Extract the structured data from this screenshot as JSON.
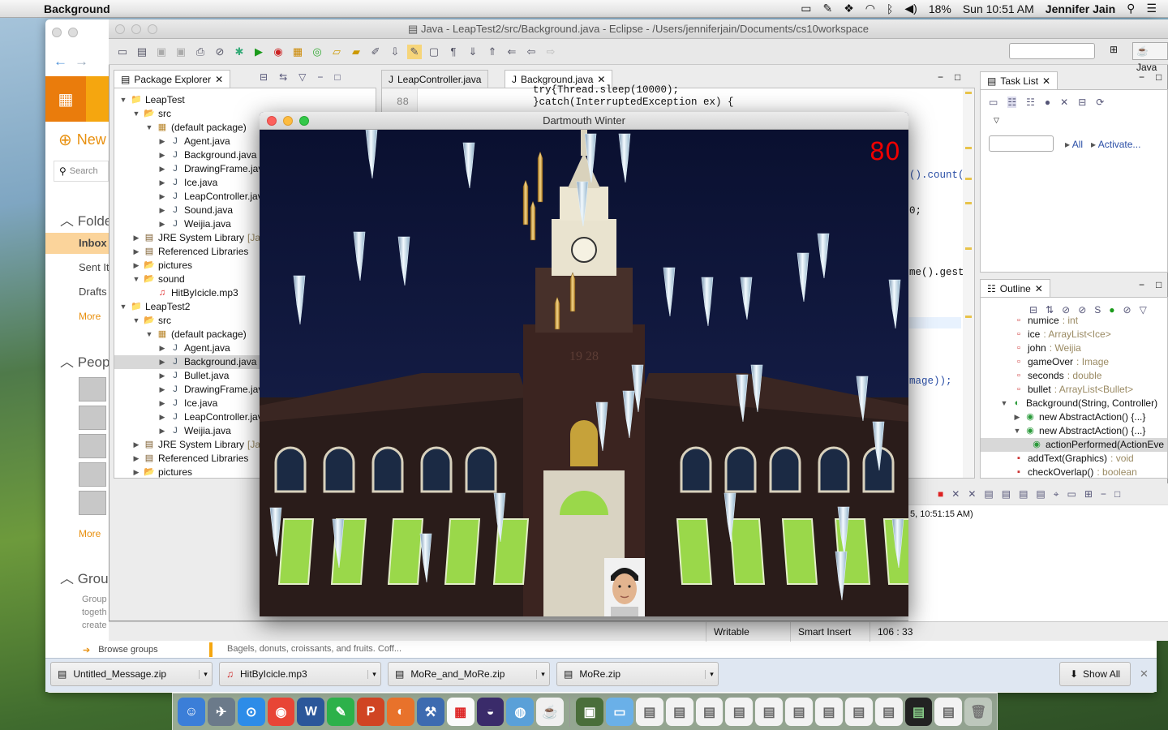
{
  "menubar": {
    "app_name": "Background",
    "battery": "18%",
    "clock": "Sun 10:51 AM",
    "user": "Jennifer Jain"
  },
  "mail": {
    "new_label": "New",
    "search_placeholder": "Search",
    "folders_header": "Folde",
    "folders": [
      "Inbox",
      "Sent Ite",
      "Drafts"
    ],
    "folders_more": "More",
    "people_header": "Peop",
    "people_more": "More",
    "groups_header": "Grou",
    "groups_text": [
      "Group",
      "togeth",
      "create"
    ],
    "browse_groups": "Browse groups",
    "preview_text": "Bagels, donuts, croissants, and fruits. Coff..."
  },
  "eclipse": {
    "title": "Java - LeapTest2/src/Background.java - Eclipse - /Users/jenniferjain/Documents/cs10workspace",
    "perspective": "Java",
    "package_explorer": {
      "tab": "Package Explorer",
      "tree": [
        {
          "level": 0,
          "twisty": "▼",
          "icon": "project",
          "label": "LeapTest"
        },
        {
          "level": 1,
          "twisty": "▼",
          "icon": "folder",
          "label": "src"
        },
        {
          "level": 2,
          "twisty": "▼",
          "icon": "package",
          "label": "(default package)"
        },
        {
          "level": 3,
          "twisty": "▶",
          "icon": "java",
          "label": "Agent.java"
        },
        {
          "level": 3,
          "twisty": "▶",
          "icon": "java",
          "label": "Background.java"
        },
        {
          "level": 3,
          "twisty": "▶",
          "icon": "java",
          "label": "DrawingFrame.jav"
        },
        {
          "level": 3,
          "twisty": "▶",
          "icon": "java",
          "label": "Ice.java"
        },
        {
          "level": 3,
          "twisty": "▶",
          "icon": "java",
          "label": "LeapController.jav"
        },
        {
          "level": 3,
          "twisty": "▶",
          "icon": "java",
          "label": "Sound.java"
        },
        {
          "level": 3,
          "twisty": "▶",
          "icon": "java",
          "label": "Weijia.java"
        },
        {
          "level": 1,
          "twisty": "▶",
          "icon": "library",
          "label": "JRE System Library",
          "suffix": "[Jav"
        },
        {
          "level": 1,
          "twisty": "▶",
          "icon": "library",
          "label": "Referenced Libraries"
        },
        {
          "level": 1,
          "twisty": "▶",
          "icon": "folder",
          "label": "pictures"
        },
        {
          "level": 1,
          "twisty": "▼",
          "icon": "folder",
          "label": "sound"
        },
        {
          "level": 2,
          "twisty": "",
          "icon": "mp3",
          "label": "HitByIcicle.mp3"
        },
        {
          "level": 0,
          "twisty": "▼",
          "icon": "project",
          "label": "LeapTest2"
        },
        {
          "level": 1,
          "twisty": "▼",
          "icon": "folder",
          "label": "src"
        },
        {
          "level": 2,
          "twisty": "▼",
          "icon": "package",
          "label": "(default package)"
        },
        {
          "level": 3,
          "twisty": "▶",
          "icon": "java",
          "label": "Agent.java"
        },
        {
          "level": 3,
          "twisty": "▶",
          "icon": "java",
          "label": "Background.java",
          "selected": true
        },
        {
          "level": 3,
          "twisty": "▶",
          "icon": "java",
          "label": "Bullet.java"
        },
        {
          "level": 3,
          "twisty": "▶",
          "icon": "java",
          "label": "DrawingFrame.jav"
        },
        {
          "level": 3,
          "twisty": "▶",
          "icon": "java",
          "label": "Ice.java"
        },
        {
          "level": 3,
          "twisty": "▶",
          "icon": "java",
          "label": "LeapController.jav"
        },
        {
          "level": 3,
          "twisty": "▶",
          "icon": "java",
          "label": "Weijia.java"
        },
        {
          "level": 1,
          "twisty": "▶",
          "icon": "library",
          "label": "JRE System Library",
          "suffix": "[Jav"
        },
        {
          "level": 1,
          "twisty": "▶",
          "icon": "library",
          "label": "Referenced Libraries"
        },
        {
          "level": 1,
          "twisty": "▶",
          "icon": "folder",
          "label": "pictures"
        }
      ]
    },
    "editor": {
      "tabs": [
        "LeapController.java",
        "Background.java"
      ],
      "line_numbers": [
        "88"
      ],
      "code_lines": [
        "try{Thread.sleep(10000);",
        "}catch(InterruptedException ex) {"
      ],
      "code_fragments": [
        "().count()",
        "0;",
        "me().gestu",
        "mage));"
      ]
    },
    "task_list": {
      "tab": "Task List",
      "all_label": "All",
      "activate_label": "Activate..."
    },
    "outline": {
      "tab": "Outline",
      "items": [
        {
          "name": "numice",
          "type": ": int"
        },
        {
          "name": "ice",
          "type": ": ArrayList<Ice>"
        },
        {
          "name": "john",
          "type": ": Weijia"
        },
        {
          "name": "gameOver",
          "type": ": Image"
        },
        {
          "name": "seconds",
          "type": ": double"
        },
        {
          "name": "bullet",
          "type": ": ArrayList<Bullet>"
        },
        {
          "name": "Background(String, Controller)",
          "type": ""
        },
        {
          "name": "new AbstractAction() {...}",
          "type": ""
        },
        {
          "name": "new AbstractAction() {...}",
          "type": ""
        },
        {
          "name": "actionPerformed(ActionEve",
          "type": ""
        },
        {
          "name": "addText(Graphics)",
          "type": ": void"
        },
        {
          "name": "checkOverlap()",
          "type": ": boolean"
        }
      ]
    },
    "console_text": "5, 10:51:15 AM)",
    "status": {
      "writable": "Writable",
      "insert_mode": "Smart Insert",
      "position": "106 : 33"
    }
  },
  "game": {
    "title": "Dartmouth Winter",
    "score": "80",
    "tower_year": "19 28"
  },
  "downloads": {
    "items": [
      "Untitled_Message.zip",
      "HitByIcicle.mp3",
      "MoRe_and_MoRe.zip",
      "MoRe.zip"
    ],
    "show_all": "Show All"
  },
  "colors": {
    "mail_orange": "#f5a60f",
    "score_red": "#e00000",
    "night_sky": "#0b1230",
    "window_green": "#9ad84a"
  }
}
